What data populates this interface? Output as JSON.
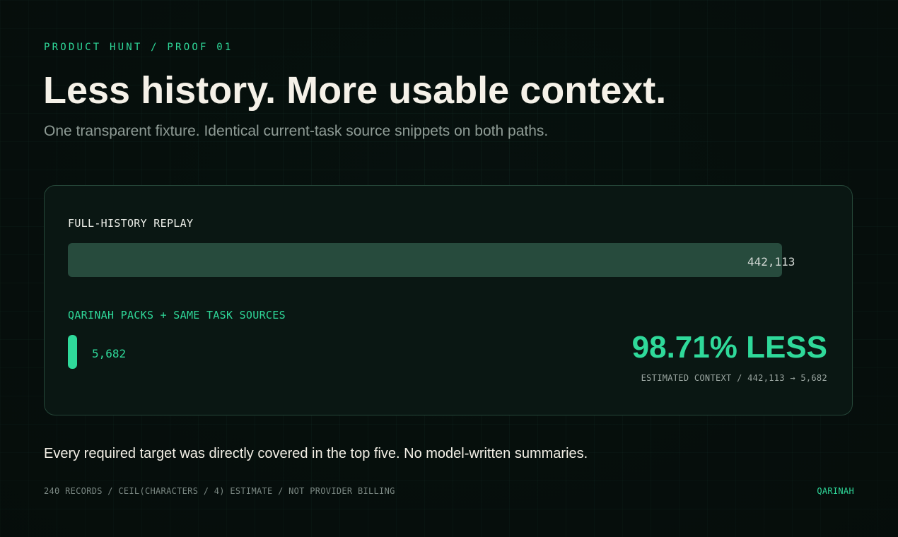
{
  "eyebrow": "PRODUCT HUNT / PROOF 01",
  "headline": "Less history. More usable context.",
  "subhead": "One transparent fixture. Identical current-task source snippets on both paths.",
  "comparison": {
    "full": {
      "label": "FULL-HISTORY REPLAY",
      "value": 442113,
      "value_text": "442,113"
    },
    "qarinah": {
      "label": "QARINAH PACKS + SAME TASK SOURCES",
      "value": 5682,
      "value_text": "5,682"
    },
    "reduction": "98.71% LESS",
    "estimate_note": "ESTIMATED CONTEXT / 442,113 → 5,682"
  },
  "footnote": "Every required target was directly covered in the top five. No model-written summaries.",
  "meta": "240 RECORDS / CEIL(CHARACTERS / 4) ESTIMATE / NOT PROVIDER BILLING",
  "brand": "QARINAH",
  "colors": {
    "accent": "#2fd99a",
    "full_bar": "#274b3d",
    "background": "#07110e"
  }
}
